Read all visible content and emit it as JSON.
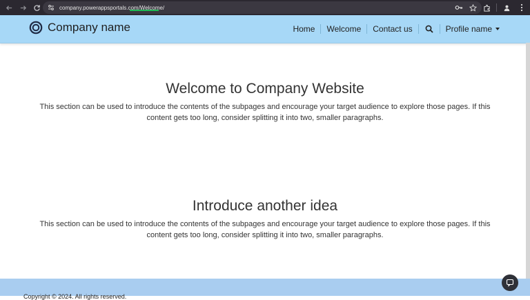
{
  "browser": {
    "url_host": "company.powerappsportals.com/",
    "url_path": "Welcome/",
    "icons": [
      "back-arrow-icon",
      "forward-arrow-icon",
      "reload-icon",
      "site-info-icon",
      "key-icon",
      "star-icon",
      "extensions-icon",
      "profile-icon",
      "menu-icon"
    ]
  },
  "header": {
    "brand_name": "Company name",
    "nav": [
      {
        "label": "Home"
      },
      {
        "label": "Welcome"
      },
      {
        "label": "Contact us"
      }
    ],
    "profile_label": "Profile name"
  },
  "sections": [
    {
      "title": "Welcome to Company Website",
      "body": "This section can be used to introduce the contents of the subpages and encourage your target audience to explore those pages. If this content gets too long, consider splitting it into two, smaller paragraphs."
    },
    {
      "title": "Introduce another idea",
      "body": "This section can be used to introduce the contents of the subpages and encourage your target audience to explore those pages. If this content gets too long, consider splitting it into two, smaller paragraphs."
    }
  ],
  "footer": {
    "copyright": "Copyright © 2024. All rights reserved."
  },
  "colors": {
    "header_bg": "#a7d8f7",
    "footer_bg": "#a9cdf0",
    "chrome_bg": "#2b2830",
    "url_underline": "#1db954"
  }
}
